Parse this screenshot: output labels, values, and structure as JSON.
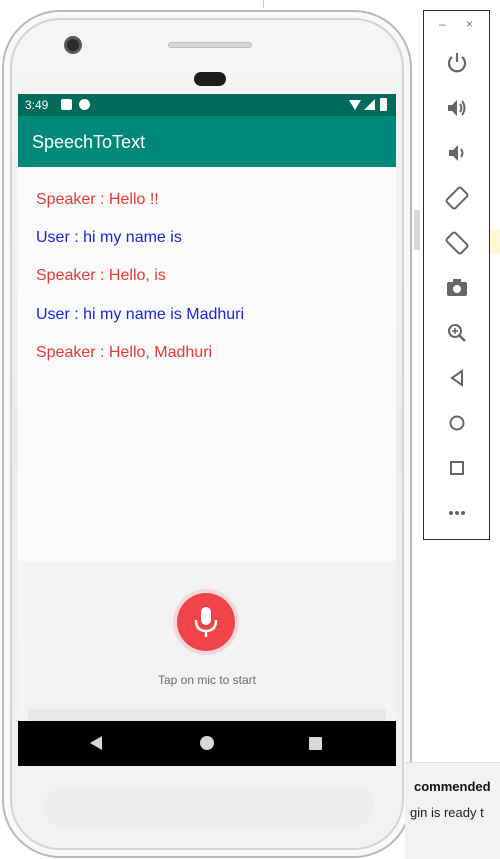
{
  "app": {
    "title": "SpeechToText",
    "status_time": "3:49"
  },
  "transcript": [
    {
      "speaker": "Speaker",
      "text": "Speaker : Hello !!",
      "color": "#e53935"
    },
    {
      "speaker": "User",
      "text": "User : hi my name is",
      "color": "#1a27d6"
    },
    {
      "speaker": "Speaker",
      "text": "Speaker : Hello, is",
      "color": "#e53935"
    },
    {
      "speaker": "User",
      "text": "User : hi my name is Madhuri",
      "color": "#1a27d6"
    },
    {
      "speaker": "Speaker",
      "text": "Speaker : Hello, Madhuri",
      "color": "#e53935"
    }
  ],
  "mic": {
    "hint": "Tap on mic to start",
    "icon": "microphone-icon",
    "color": "#f0444a"
  },
  "nav": {
    "back_icon": "back-triangle-icon",
    "home_icon": "home-circle-icon",
    "recents_icon": "recents-square-icon"
  },
  "emulator_toolbar": {
    "minimize": "–",
    "close": "×",
    "buttons": [
      "power-icon",
      "volume-up-icon",
      "volume-down-icon",
      "rotate-left-icon",
      "rotate-right-icon",
      "camera-icon",
      "zoom-icon",
      "back-icon",
      "home-icon",
      "overview-icon",
      "more-icon"
    ]
  },
  "notification": {
    "title": "commended",
    "body": "gin is ready t"
  },
  "colors": {
    "status_bar": "#006b5a",
    "app_bar": "#00897b",
    "speaker_text": "#e53935",
    "user_text": "#1a27d6"
  }
}
